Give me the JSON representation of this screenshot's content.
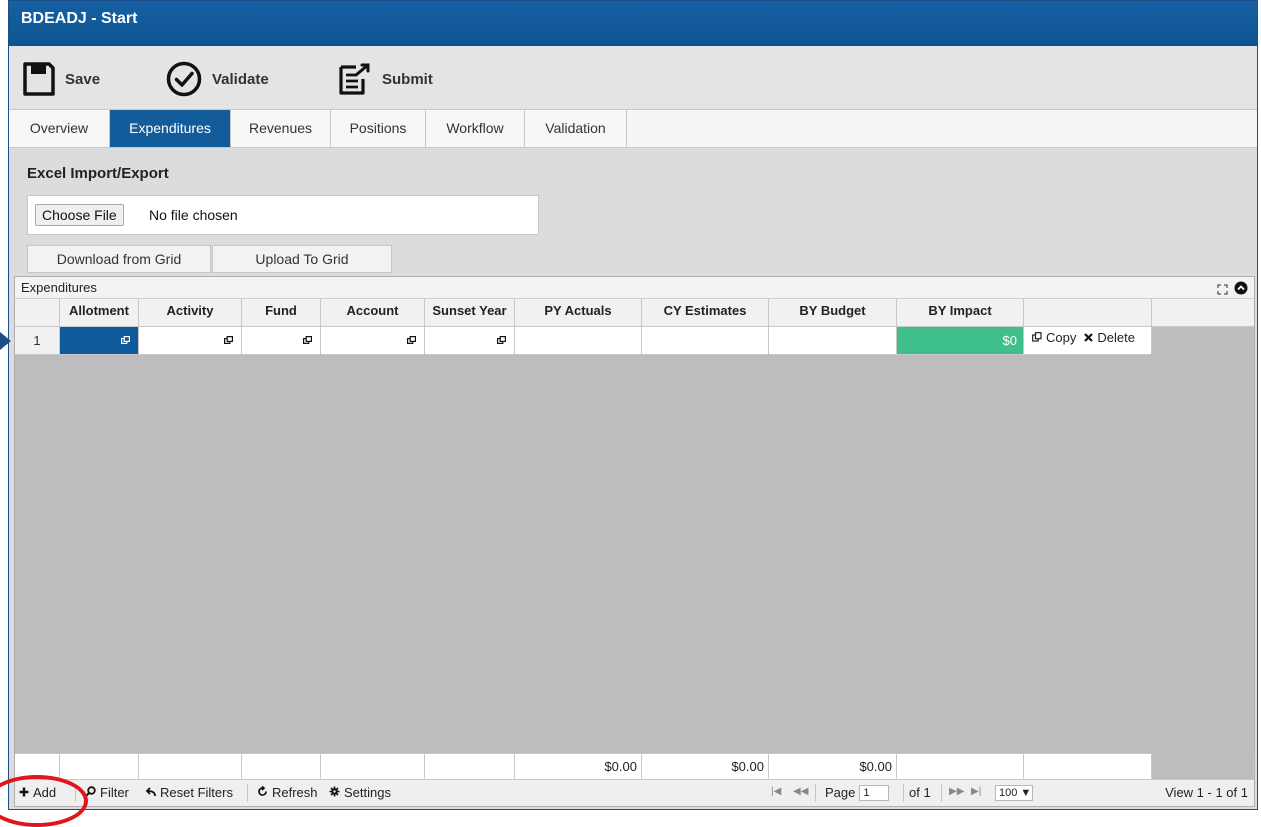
{
  "window": {
    "title": "BDEADJ - Start"
  },
  "toolbar": {
    "save": {
      "label": "Save",
      "icon": "save-icon"
    },
    "validate": {
      "label": "Validate",
      "icon": "check-circle-icon"
    },
    "submit": {
      "label": "Submit",
      "icon": "submit-icon"
    }
  },
  "tabs": [
    {
      "label": "Overview",
      "active": false
    },
    {
      "label": "Expenditures",
      "active": true
    },
    {
      "label": "Revenues",
      "active": false
    },
    {
      "label": "Positions",
      "active": false
    },
    {
      "label": "Workflow",
      "active": false
    },
    {
      "label": "Validation",
      "active": false
    }
  ],
  "import": {
    "title": "Excel Import/Export",
    "choose_file_label": "Choose File",
    "file_status": "No file chosen",
    "download_label": "Download from Grid",
    "upload_label": "Upload To Grid"
  },
  "grid": {
    "caption": "Expenditures",
    "columns": [
      "Allotment",
      "Activity",
      "Fund",
      "Account",
      "Sunset Year",
      "PY Actuals",
      "CY Estimates",
      "BY Budget",
      "BY Impact",
      ""
    ],
    "rows": [
      {
        "num": "1",
        "allotment": "",
        "activity": "",
        "fund": "",
        "account": "",
        "sunset_year": "",
        "py_actuals": "",
        "cy_estimates": "",
        "by_budget": "",
        "by_impact": "$0",
        "copy_label": "Copy",
        "delete_label": "Delete"
      }
    ],
    "totals": {
      "py_actuals": "$0.00",
      "cy_estimates": "$0.00",
      "by_budget": "$0.00"
    }
  },
  "pager": {
    "add_label": "Add",
    "filter_label": "Filter",
    "reset_filters_label": "Reset Filters",
    "refresh_label": "Refresh",
    "settings_label": "Settings",
    "page_label": "Page",
    "page_value": "1",
    "of_label": "of 1",
    "rows_per_page": "100",
    "view_label": "View 1 - 1 of 1"
  },
  "colors": {
    "title_bar": "#105a9a",
    "active_tab": "#135c9b",
    "selected_cell": "#0f5a9c",
    "impact_cell": "#3fbf8a",
    "annotation": "#e0161c"
  }
}
